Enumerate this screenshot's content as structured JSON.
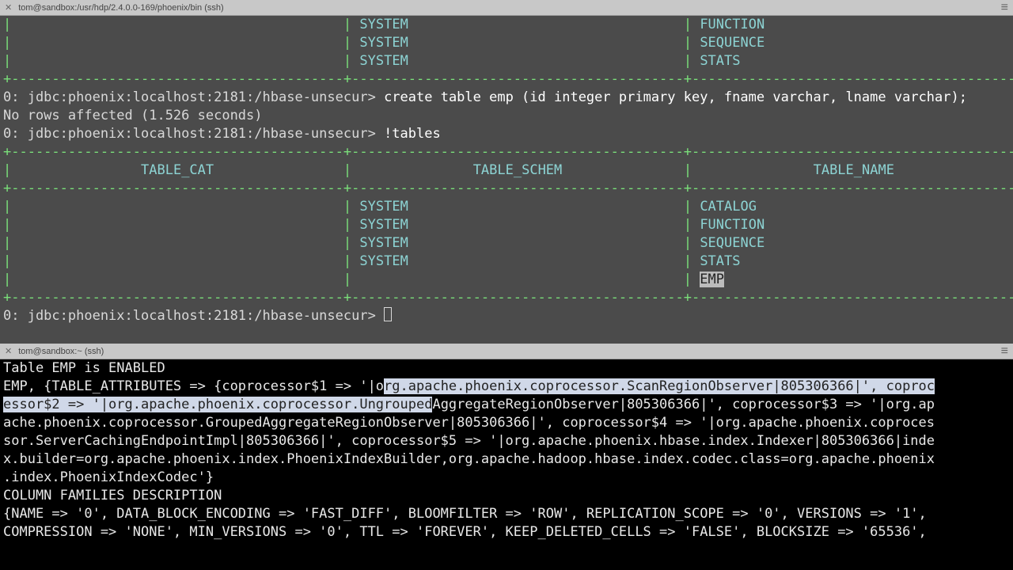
{
  "top_pane": {
    "titlebar": "tom@sandbox:/usr/hdp/2.4.0.0-169/phoenix/bin (ssh)",
    "pretable_b": {
      "rows": [
        {
          "schem": "SYSTEM",
          "name": "FUNCTION"
        },
        {
          "schem": "SYSTEM",
          "name": "SEQUENCE"
        },
        {
          "schem": "SYSTEM",
          "name": "STATS"
        }
      ]
    },
    "prompt1": "0: jdbc:phoenix:localhost:2181:/hbase-unsecur>",
    "cmd1": "create table emp (id integer primary key, fname varchar, lname varchar);",
    "result1": "No rows affected (1.526 seconds)",
    "prompt2": "0: jdbc:phoenix:localhost:2181:/hbase-unsecur>",
    "cmd2": "!tables",
    "headers": {
      "c1": "TABLE_CAT",
      "c2": "TABLE_SCHEM",
      "c3": "TABLE_NAME"
    },
    "rows2": [
      {
        "schem": "SYSTEM",
        "name": "CATALOG"
      },
      {
        "schem": "SYSTEM",
        "name": "FUNCTION"
      },
      {
        "schem": "SYSTEM",
        "name": "SEQUENCE"
      },
      {
        "schem": "SYSTEM",
        "name": "STATS"
      },
      {
        "schem": "",
        "name": "EMP"
      }
    ],
    "prompt3": "0: jdbc:phoenix:localhost:2181:/hbase-unsecur>"
  },
  "bottom_pane": {
    "titlebar": "tom@sandbox:~ (ssh)",
    "l1": "Table EMP is ENABLED",
    "l2a": "EMP, {TABLE_ATTRIBUTES => {coprocessor$1 => '|o",
    "l2b": "rg.apache.phoenix.coprocessor.ScanRegionObserver|805306366|', coproc",
    "l3a": "essor$2 => '|org.apache.phoenix.coprocessor.Ungrouped",
    "l3b": "AggregateRegionObserver|805306366|', coprocessor$3 => '|org.ap",
    "l4": "ache.phoenix.coprocessor.GroupedAggregateRegionObserver|805306366|', coprocessor$4 => '|org.apache.phoenix.coproces",
    "l5": "sor.ServerCachingEndpointImpl|805306366|', coprocessor$5 => '|org.apache.phoenix.hbase.index.Indexer|805306366|inde",
    "l6": "x.builder=org.apache.phoenix.index.PhoenixIndexBuilder,org.apache.hadoop.hbase.index.codec.class=org.apache.phoenix",
    "l7": ".index.PhoenixIndexCodec'}",
    "l8": "COLUMN FAMILIES DESCRIPTION",
    "l9": "{NAME => '0', DATA_BLOCK_ENCODING => 'FAST_DIFF', BLOOMFILTER => 'ROW', REPLICATION_SCOPE => '0', VERSIONS => '1',",
    "l10": "COMPRESSION => 'NONE', MIN_VERSIONS => '0', TTL => 'FOREVER', KEEP_DELETED_CELLS => 'FALSE', BLOCKSIZE => '65536',"
  }
}
